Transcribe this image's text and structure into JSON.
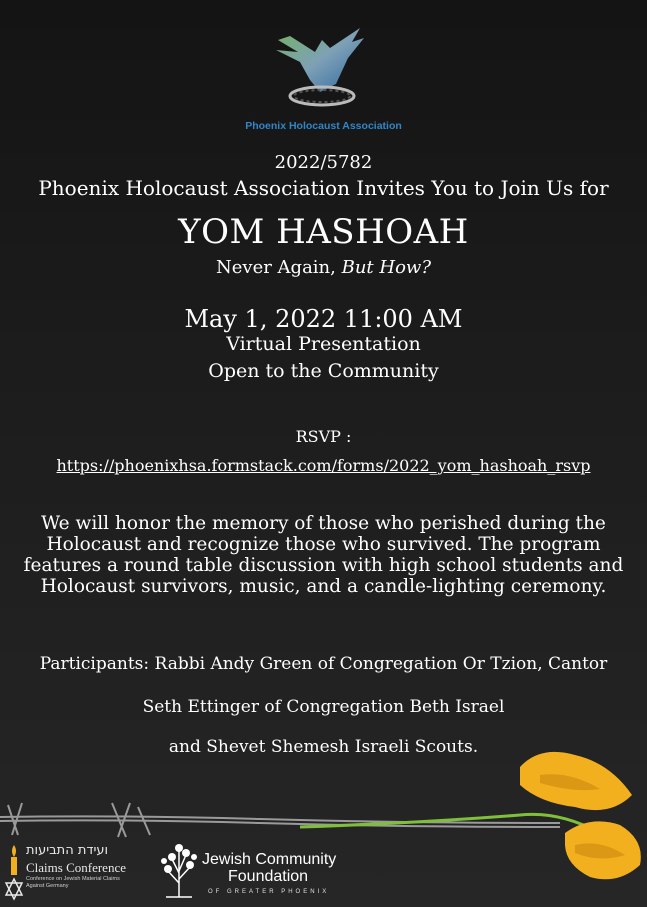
{
  "organization": {
    "name": "Phoenix Holocaust Association"
  },
  "header": {
    "year": "2022/5782",
    "invite": "Phoenix Holocaust Association Invites You to Join Us for"
  },
  "event": {
    "title": "YOM HASHOAH",
    "tagline_plain": "Never Again, ",
    "tagline_italic": "But How?",
    "datetime": "May 1, 2022 11:00 AM",
    "venue": "Virtual Presentation",
    "audience": "Open to the Community"
  },
  "rsvp": {
    "label": "RSVP :",
    "link": "https://phoenixhsa.formstack.com/forms/2022_yom_hashoah_rsvp"
  },
  "description": "We will honor the memory of those who perished during the Holocaust and recognize those who survived. The program features a round table discussion with high school students and Holocaust survivors, music, and a candle-lighting ceremony.",
  "participants": {
    "line1": "Participants: Rabbi Andy Green of Congregation Or Tzion, Cantor",
    "line2": "Seth Ettinger of Congregation Beth Israel",
    "line3": "and Shevet Shemesh Israeli Scouts."
  },
  "sponsors": {
    "claims_hebrew": "ועידת התביעות",
    "claims_name": "Claims Conference",
    "claims_sub": "Conference on Jewish Material Claims Against Germany",
    "jcf_line1": "Jewish Community",
    "jcf_line2": "Foundation",
    "jcf_sub": "OF GREATER PHOENIX"
  },
  "colors": {
    "background": "#1a1a1a",
    "text": "#ffffff",
    "org_blue": "#2f86c9",
    "flower": "#f2b01e"
  }
}
